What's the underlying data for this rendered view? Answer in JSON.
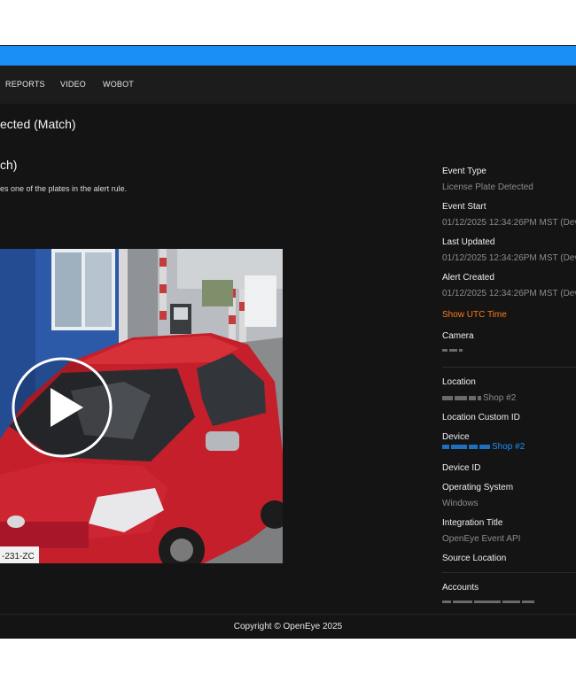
{
  "nav": {
    "items": [
      "REPORTS",
      "VIDEO",
      "WOBOT"
    ]
  },
  "page": {
    "title": "ected (Match)",
    "alert_title": "ch)",
    "alert_description": "es one of the plates in the alert rule."
  },
  "video": {
    "plate_text": "-231-ZC",
    "brand_color": "#e0252b"
  },
  "details": {
    "event_type_label": "Event Type",
    "event_type_value": "License Plate Detected",
    "event_start_label": "Event Start",
    "event_start_value": "01/12/2025 12:34:26PM MST (Dev",
    "last_updated_label": "Last Updated",
    "last_updated_value": "01/12/2025 12:34:26PM MST (Dev",
    "alert_created_label": "Alert Created",
    "alert_created_value": "01/12/2025 12:34:26PM MST (Dev",
    "show_utc_link": "Show UTC Time",
    "camera_label": "Camera",
    "location_label": "Location",
    "location_value_suffix": "Shop #2",
    "location_custom_id_label": "Location Custom ID",
    "device_label": "Device",
    "device_value_suffix": "Shop #2",
    "device_id_label": "Device ID",
    "os_label": "Operating System",
    "os_value": "Windows",
    "integration_title_label": "Integration Title",
    "integration_title_value": "OpenEye Event API",
    "source_location_label": "Source Location",
    "accounts_label": "Accounts"
  },
  "footer": {
    "copyright": "Copyright © OpenEye 2025"
  },
  "colors": {
    "topbar": "#1890f5",
    "link_orange": "#ff7a1a",
    "link_blue": "#1e90ff",
    "background": "#141414"
  }
}
